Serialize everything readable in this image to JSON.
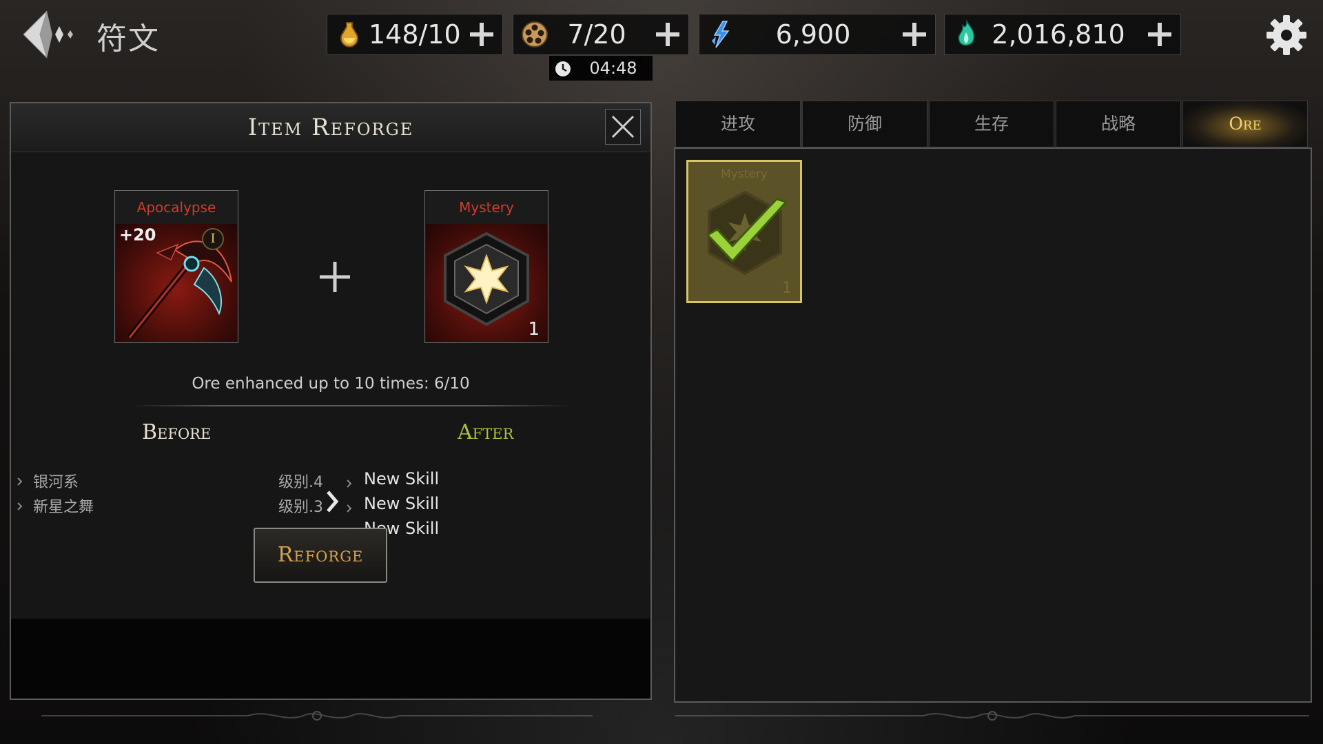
{
  "header": {
    "title": "符文",
    "back_icon": "back-arrow-icon",
    "settings_icon": "gear-icon"
  },
  "resources": [
    {
      "id": "stamina",
      "icon": "potion-icon",
      "value": "148/10"
    },
    {
      "id": "tickets",
      "icon": "film-reel-icon",
      "value": "7/20"
    },
    {
      "id": "crystals",
      "icon": "blue-crystal-icon",
      "value": "6,900"
    },
    {
      "id": "souls",
      "icon": "green-soul-flame-icon",
      "value": "2,016,810"
    }
  ],
  "timer": {
    "text": "04:48"
  },
  "reforge_panel": {
    "title": "Item Reforge",
    "target_item": {
      "name": "Apocalypse",
      "level": "+20",
      "tier": "I"
    },
    "ore_item": {
      "name": "Mystery",
      "count": "1"
    },
    "enhance_text": "Ore enhanced up to 10 times: 6/10",
    "before_label": "Before",
    "after_label": "After",
    "before_skills": [
      {
        "name": "银河系",
        "level": "级别.4"
      },
      {
        "name": "新星之舞",
        "level": "级别.3"
      }
    ],
    "after_skills": [
      {
        "name": "New Skill"
      },
      {
        "name": "New Skill"
      },
      {
        "name": "New Skill"
      }
    ],
    "reforge_button": "Reforge"
  },
  "tabs": [
    {
      "label": "进攻",
      "active": false
    },
    {
      "label": "防御",
      "active": false
    },
    {
      "label": "生存",
      "active": false
    },
    {
      "label": "战略",
      "active": false
    },
    {
      "label": "Ore",
      "active": true
    }
  ],
  "inventory": [
    {
      "name": "Mystery",
      "count": "1",
      "selected": true
    }
  ],
  "colors": {
    "item_name_red": "#d33a2a",
    "after_green": "#a6c43a",
    "reforge_gold": "#d8a24a",
    "selected_check": "#9bd23a"
  }
}
